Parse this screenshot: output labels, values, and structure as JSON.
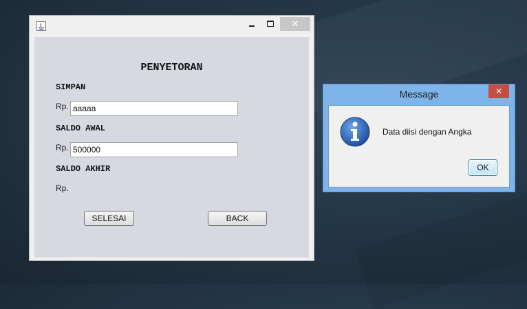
{
  "main_window": {
    "heading": "PENYETORAN",
    "simpan_label": "SIMPAN",
    "simpan_currency": "Rp.",
    "simpan_value": "aaaaa",
    "saldo_awal_label": "SALDO AWAL",
    "saldo_awal_currency": "Rp.",
    "saldo_awal_value": "500000",
    "saldo_akhir_label": "SALDO AKHIR",
    "saldo_akhir_currency": "Rp.",
    "selesai_label": "SELESAI",
    "back_label": "BACK",
    "close_glyph": "✕"
  },
  "dialog": {
    "title": "Message",
    "message": "Data diisi dengan Angka",
    "ok_label": "OK",
    "close_glyph": "✕",
    "icon": "info-icon"
  },
  "colors": {
    "dialog_frame": "#7fb4ea",
    "dialog_close": "#c74d43",
    "content_bg": "#d6d9df",
    "desktop": "#223444"
  }
}
